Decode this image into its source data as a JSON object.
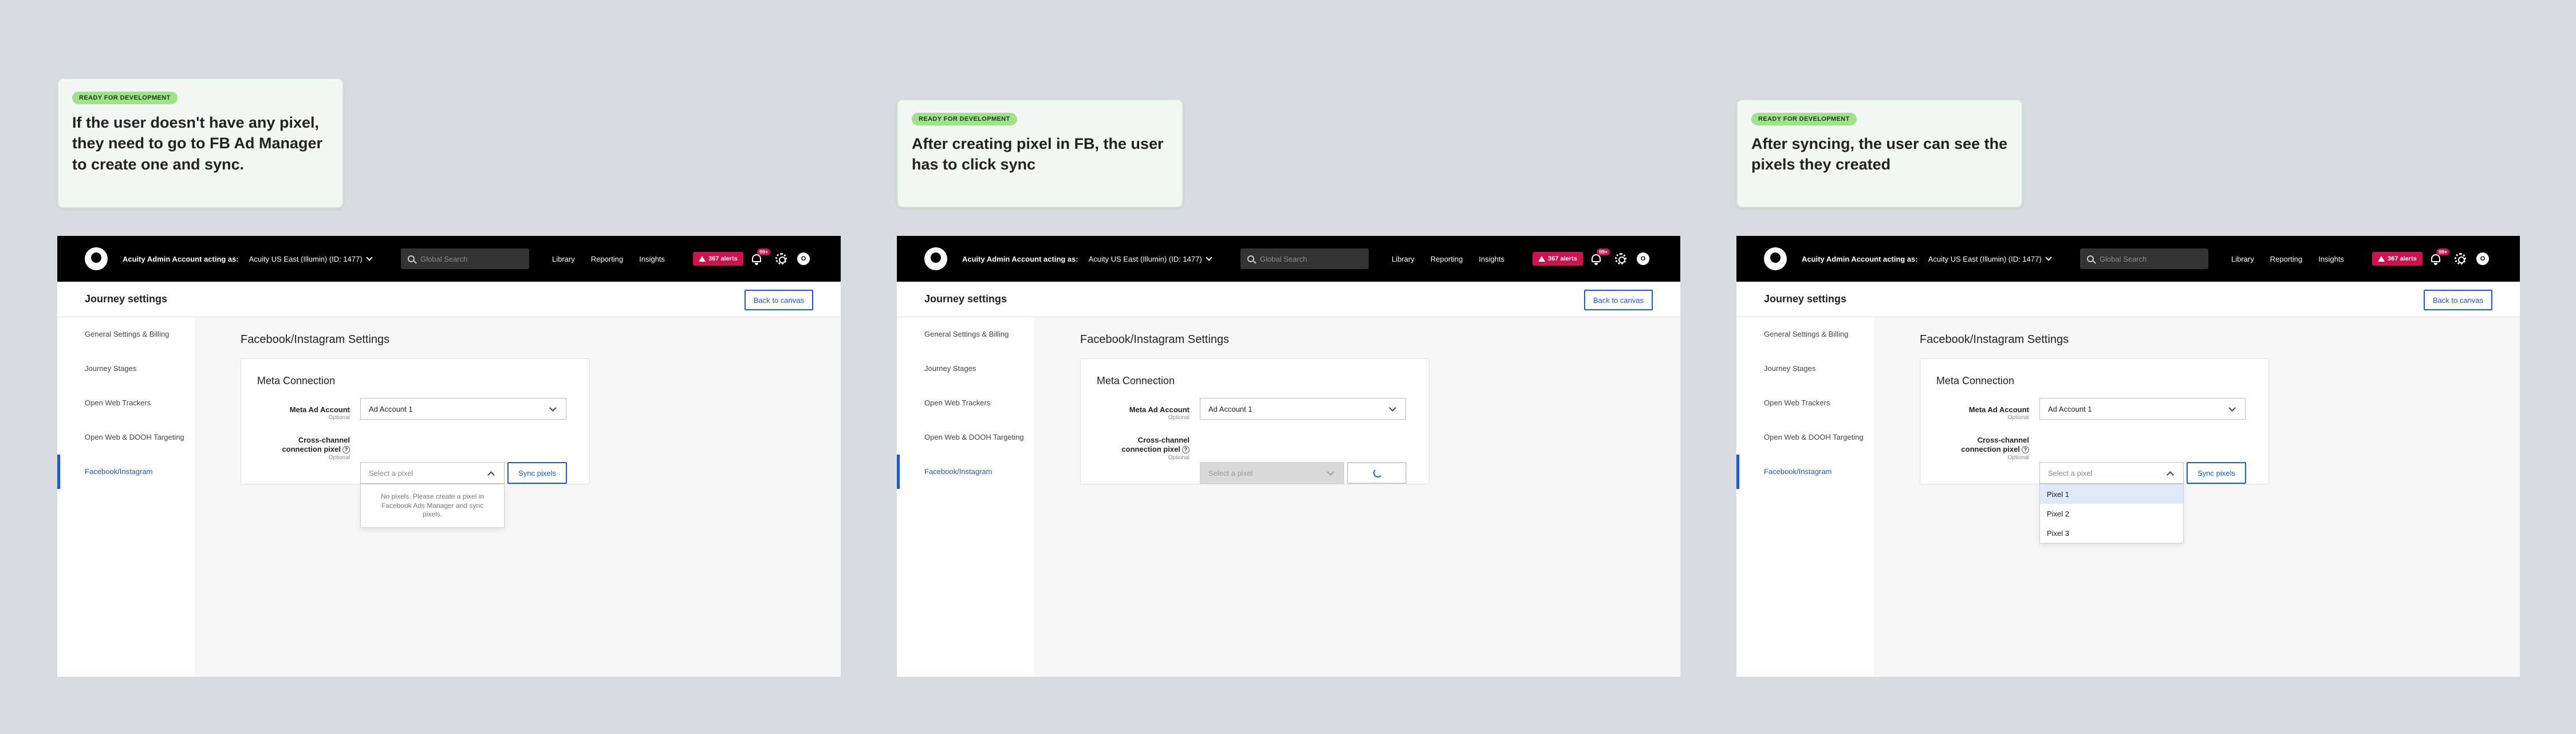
{
  "notes": [
    {
      "badge": "READY FOR DEVELOPMENT",
      "text": "If the user doesn't have any pixel, they need to go to FB Ad Manager to create one and sync."
    },
    {
      "badge": "READY FOR DEVELOPMENT",
      "text": "After creating pixel in FB, the user has to click sync"
    },
    {
      "badge": "READY FOR DEVELOPMENT",
      "text": "After syncing, the user can see the pixels they created"
    }
  ],
  "topbar": {
    "acting_as_label": "Acuity Admin Account acting as:",
    "account_value": "Acuity US East (Illumin) (ID: 1477)",
    "search_placeholder": "Global Search",
    "nav": [
      "Library",
      "Reporting",
      "Insights"
    ],
    "alerts_label": "367 alerts",
    "notifications_count": "99+",
    "avatar_initial": "O"
  },
  "subheader": {
    "title": "Journey settings",
    "back_button": "Back to canvas"
  },
  "sidebar": {
    "items": [
      {
        "label": "General Settings & Billing"
      },
      {
        "label": "Journey Stages"
      },
      {
        "label": "Open Web Trackers"
      },
      {
        "label": "Open Web & DOOH Targeting"
      },
      {
        "label": "Facebook/Instagram"
      }
    ]
  },
  "page": {
    "title": "Facebook/Instagram Settings",
    "card_title": "Meta Connection",
    "meta_ad_account_label": "Meta Ad Account",
    "optional": "Optional",
    "meta_ad_account_value": "Ad Account 1",
    "pixel_label_line1": "Cross-channel",
    "pixel_label_line2": "connection pixel",
    "help_glyph": "?",
    "pixel_placeholder": "Select a pixel",
    "sync_button": "Sync pixels",
    "no_pixels_message": "No pixels. Please create a pixel in Facebook Ads Manager and sync pixels.",
    "pixel_options": [
      "Pixel 1",
      "Pixel 2",
      "Pixel 3"
    ]
  },
  "colors": {
    "accent": "#1f56d6",
    "alert": "#d0114f",
    "badge": "#9fe28a"
  }
}
